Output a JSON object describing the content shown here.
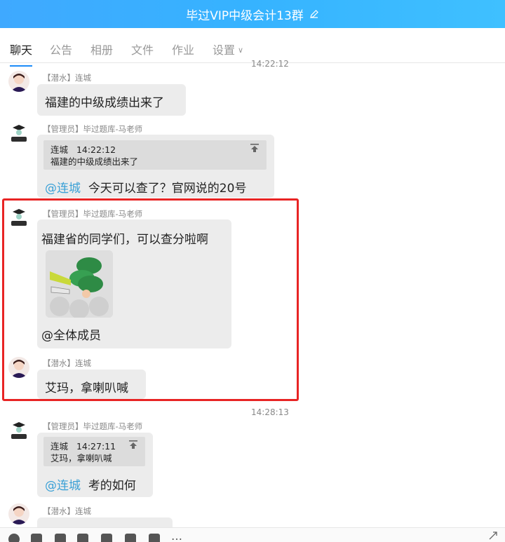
{
  "window": {
    "title": "毕过VIP中级会计13群"
  },
  "tabs": [
    {
      "label": "聊天",
      "active": true
    },
    {
      "label": "公告"
    },
    {
      "label": "相册"
    },
    {
      "label": "文件"
    },
    {
      "label": "作业"
    },
    {
      "label": "设置"
    }
  ],
  "timestamps": [
    "14:22:12",
    "14:28:13"
  ],
  "messages": [
    {
      "sender": "【潜水】连城",
      "text": "福建的中级成绩出来了",
      "avatar": "avatar-icon"
    },
    {
      "sender": "【管理员】毕过题库-马老师",
      "quote": {
        "author": "连城",
        "time": "14:22:12",
        "text": "福建的中级成绩出来了"
      },
      "mention": "@连城",
      "text": "今天可以查了？官网说的20号",
      "avatar": "logo-avatar"
    },
    {
      "sender": "【管理员】毕过题库-马老师",
      "text": "福建省的同学们，可以查分啦啊",
      "sticker": "trumpet-soldiers-sticker",
      "mention": "@全体成员",
      "avatar": "logo-avatar"
    },
    {
      "sender": "【潜水】连城",
      "text": "艾玛，拿喇叭喊",
      "avatar": "avatar-icon"
    },
    {
      "sender": "【管理员】毕过题库-马老师",
      "quote": {
        "author": "连城",
        "time": "14:27:11",
        "text": "艾玛，拿喇叭喊"
      },
      "mention": "@连城",
      "text": "考的如何",
      "avatar": "logo-avatar"
    },
    {
      "sender": "【潜水】连城",
      "text": "",
      "avatar": "avatar-icon"
    }
  ],
  "colors": {
    "title_bar": "#36b3ff",
    "highlight": "#e82424",
    "mention": "#3aa0d6",
    "active_tab": "#1d8cf8"
  }
}
